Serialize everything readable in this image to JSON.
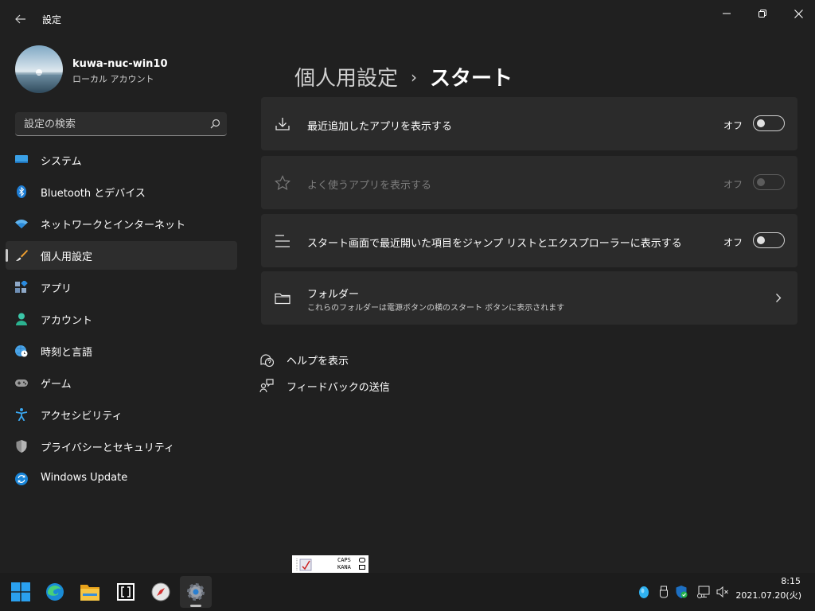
{
  "window": {
    "title": "設定"
  },
  "profile": {
    "name": "kuwa-nuc-win10",
    "account_type": "ローカル アカウント"
  },
  "search": {
    "placeholder": "設定の検索"
  },
  "nav": {
    "items": [
      {
        "label": "システム",
        "icon": "system-icon"
      },
      {
        "label": "Bluetooth とデバイス",
        "icon": "bluetooth-icon"
      },
      {
        "label": "ネットワークとインターネット",
        "icon": "wifi-icon"
      },
      {
        "label": "個人用設定",
        "icon": "brush-icon",
        "selected": true
      },
      {
        "label": "アプリ",
        "icon": "apps-icon"
      },
      {
        "label": "アカウント",
        "icon": "person-icon"
      },
      {
        "label": "時刻と言語",
        "icon": "globe-clock-icon"
      },
      {
        "label": "ゲーム",
        "icon": "gamepad-icon"
      },
      {
        "label": "アクセシビリティ",
        "icon": "accessibility-icon"
      },
      {
        "label": "プライバシーとセキュリティ",
        "icon": "shield-icon"
      },
      {
        "label": "Windows Update",
        "icon": "update-icon"
      }
    ]
  },
  "header": {
    "parent": "個人用設定",
    "separator": "›",
    "current": "スタート"
  },
  "settings": [
    {
      "label": "最近追加したアプリを表示する",
      "state": "オフ",
      "enabled": true
    },
    {
      "label": "よく使うアプリを表示する",
      "state": "オフ",
      "enabled": false
    },
    {
      "label": "スタート画面で最近開いた項目をジャンプ リストとエクスプローラーに表示する",
      "state": "オフ",
      "enabled": true
    }
  ],
  "folders": {
    "title": "フォルダー",
    "description": "これらのフォルダーは電源ボタンの横のスタート ボタンに表示されます"
  },
  "links": {
    "help": "ヘルプを表示",
    "feedback": "フィードバックの送信"
  },
  "ime": {
    "caps": "CAPS",
    "kana": "KANA"
  },
  "taskbar": {
    "time": "8:15",
    "date": "2021.07.20(火)"
  },
  "colors": {
    "background": "#202020",
    "card": "#2b2b2b",
    "accent": "#0078d4"
  }
}
